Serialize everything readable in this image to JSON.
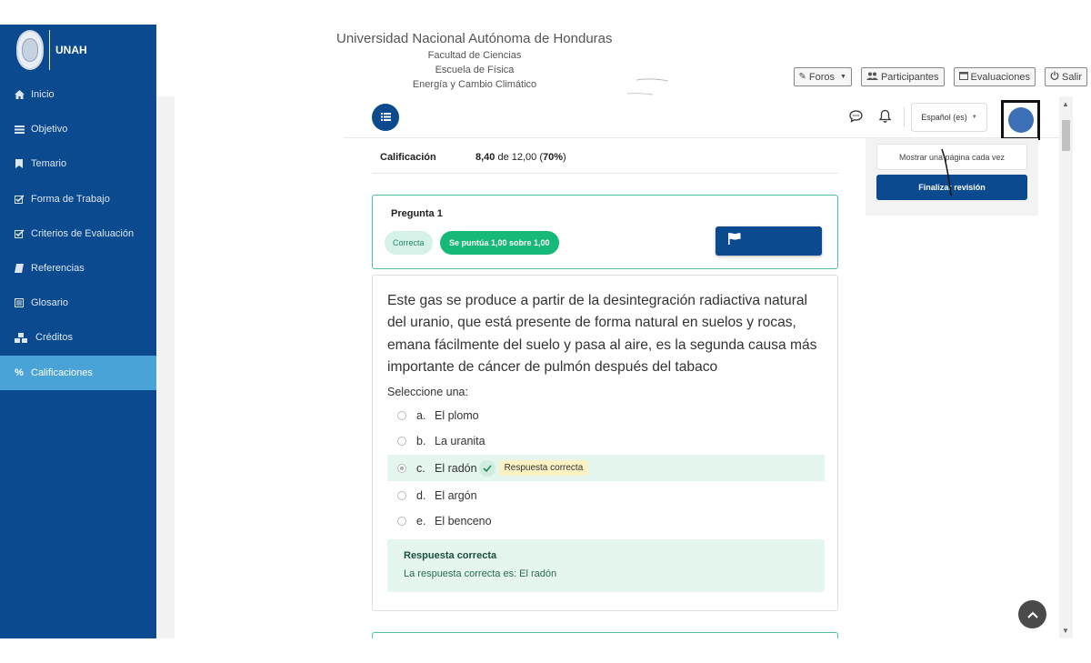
{
  "brand": {
    "name": "UNAH"
  },
  "sidebar": {
    "items": [
      {
        "label": "Inicio",
        "icon": "home-icon"
      },
      {
        "label": "Objetivo",
        "icon": "list-icon"
      },
      {
        "label": "Temario",
        "icon": "bookmark-icon"
      },
      {
        "label": "Forma de Trabajo",
        "icon": "check-square-icon"
      },
      {
        "label": "Criterios de Evaluación",
        "icon": "check-square-icon"
      },
      {
        "label": "Referencias",
        "icon": "book-icon"
      },
      {
        "label": "Glosario",
        "icon": "glossary-icon"
      },
      {
        "label": "Créditos",
        "icon": "cubes-icon"
      },
      {
        "label": "Calificaciones",
        "icon": "percent-icon",
        "active": true
      }
    ]
  },
  "header": {
    "title": "Universidad Nacional Autónoma de Honduras",
    "line1": "Facultad de Ciencias",
    "line2": "Escuela de Física",
    "line3": "Energía y Cambio Climático",
    "buttons": {
      "foros": "Foros",
      "participantes": "Participantes",
      "evaluaciones": "Evaluaciones",
      "salir": "Salir"
    }
  },
  "navbar": {
    "language": "Español (es)"
  },
  "quiz_nav": {
    "show_one_page": "Mostrar una página cada vez",
    "finish_review": "Finalizar revisión"
  },
  "summary": {
    "label": "Calificación",
    "score": "8,40",
    "of_text": " de 12,00 (",
    "percent": "70%",
    "close": ")"
  },
  "question": {
    "number": "Pregunta 1",
    "status": "Correcta",
    "points": "Se puntúa 1,00 sobre 1,00",
    "text": "Este gas se produce a partir de la desintegración radiactiva natural del uranio, que está presente de forma natural en suelos y rocas, emana fácilmente del suelo y pasa al aire, es la segunda causa más importante de cáncer de pulmón después del tabaco",
    "prompt": "Seleccione una:",
    "answers": [
      {
        "letter": "a.",
        "text": "El plomo"
      },
      {
        "letter": "b.",
        "text": "La uranita"
      },
      {
        "letter": "c.",
        "text": "El radón",
        "selected": true,
        "tag": "Respuesta correcta"
      },
      {
        "letter": "d.",
        "text": "El argón"
      },
      {
        "letter": "e.",
        "text": "El benceno"
      }
    ],
    "feedback_title": "Respuesta correcta",
    "feedback_text": "La respuesta correcta es: El radón"
  },
  "colors": {
    "sidebar": "#0b4a8f",
    "active": "#4aa3d6",
    "success": "#17b978",
    "primary": "#0b4a8f"
  }
}
